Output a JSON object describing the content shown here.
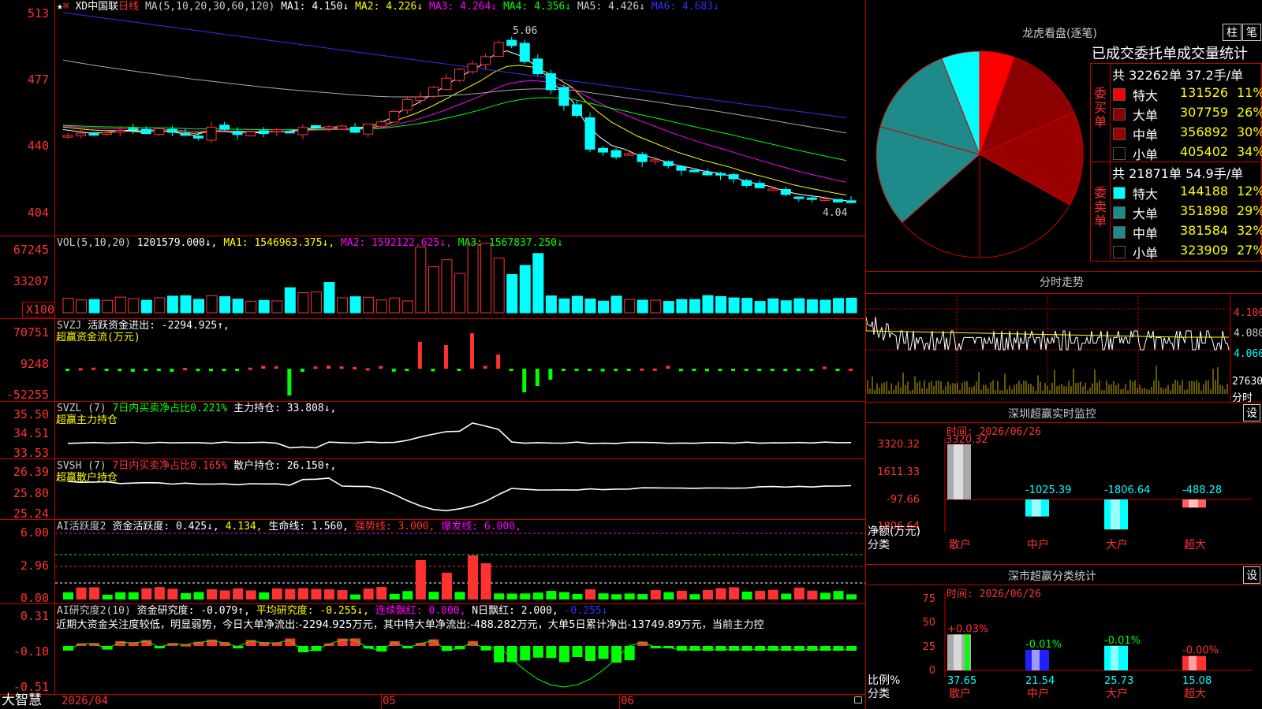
{
  "kline": {
    "title": "XD中国联",
    "period": "日线",
    "ma_label": "MA(5,10,20,30,60,120)",
    "ma1": "MA1: 4.150↓",
    "ma2": "MA2: 4.226↓",
    "ma3": "MA3: 4.264↓",
    "ma4": "MA4: 4.356↓",
    "ma5": "MA5: 4.426↓",
    "ma6": "MA6: 4.683↓",
    "y_ticks": [
      "513",
      "477",
      "440",
      "404"
    ],
    "high_note": "5.06",
    "low_note": "4.04"
  },
  "vol": {
    "label": "VOL(5,10,20)",
    "value": "1201579.000↓",
    "ma1": "MA1: 1546963.375↓",
    "ma2": "MA2: 1592122.625↓",
    "ma3": "MA3: 1567837.250↓",
    "y_ticks": [
      "67245",
      "33207",
      "X100"
    ]
  },
  "svzj": {
    "label": "SVZJ",
    "text": "活跃资金进出: -2294.925↑,",
    "sub": "超赢资金流(万元)",
    "y_ticks": [
      "70751",
      "9248",
      "-52255"
    ]
  },
  "svzl": {
    "label": "SVZL (7)",
    "text1": "7日内买卖净占比0.221%",
    "text2": "主力持仓: 33.808↓,",
    "sub": "超赢主力持仓",
    "y_ticks": [
      "35.50",
      "34.51",
      "33.53"
    ]
  },
  "svsh": {
    "label": "SVSH (7)",
    "text1": "7日内买卖净占比0.165%",
    "text2": "散户持仓: 26.150↑,",
    "sub": "超赢散户持仓",
    "y_ticks": [
      "26.39",
      "25.80",
      "25.24"
    ]
  },
  "ai1": {
    "label": "AI活跃度2",
    "t1": "资金活跃度: 0.425↓,",
    "t2": "4.134,",
    "t3": "生命线: 1.560,",
    "t4": "强势线: 3.000,",
    "t5": "爆发线: 6.000,",
    "y_ticks": [
      "6.00",
      "2.96",
      "0.00"
    ]
  },
  "ai2": {
    "label": "AI研究度2(10)",
    "t1": "资金研究度: -0.079↑,",
    "t2": "平均研究度: -0.255↓,",
    "t3": "连续飘红: 0.000,",
    "t4": "N日飘红: 2.000,",
    "t5": "-0.255↓",
    "comment": "近期大资金关注度较低，明显弱势，今日大单净流出:-2294.925万元，其中特大单净流出:-488.282万元，大单5日累计净出-13749.89万元，当前主力控",
    "y_ticks": [
      "0.31",
      "-0.10",
      "-0.51"
    ]
  },
  "xaxis": {
    "brand": "大智慧",
    "d1": "2026/04",
    "d2": "05",
    "d3": "06"
  },
  "lhb": {
    "title": "龙虎看盘(逐笔)",
    "tab1": "柱",
    "tab2": "笔",
    "stat_title": "已成交委托单成交量统计",
    "buy_side": "委买单",
    "sell_side": "委卖单",
    "buy_total": "共 32262单 37.2手/单",
    "sell_total": "共 21871单 54.9手/单",
    "buy_rows": [
      {
        "name": "特大",
        "vol": "131526",
        "pct": "11%",
        "color": "#ff0000"
      },
      {
        "name": "大单",
        "vol": "307759",
        "pct": "26%",
        "color": "#8b0000"
      },
      {
        "name": "中单",
        "vol": "356892",
        "pct": "30%",
        "color": "#9a0000"
      },
      {
        "name": "小单",
        "vol": "405402",
        "pct": "34%",
        "color": "#000000"
      }
    ],
    "sell_rows": [
      {
        "name": "特大",
        "vol": "144188",
        "pct": "12%",
        "color": "#00ffff"
      },
      {
        "name": "大单",
        "vol": "351898",
        "pct": "29%",
        "color": "#1f8a8a"
      },
      {
        "name": "中单",
        "vol": "381584",
        "pct": "32%",
        "color": "#1f8a8a"
      },
      {
        "name": "小单",
        "vol": "323909",
        "pct": "27%",
        "color": "#000000"
      }
    ]
  },
  "fenshi": {
    "title": "分时走势",
    "y_ticks": [
      "4.100",
      "4.080",
      "4.060"
    ],
    "vol_tick": "27630",
    "vol_label": "分时"
  },
  "monitor": {
    "title": "深圳超赢实时监控",
    "set": "设",
    "time": "时间: 2026/06/26",
    "y_ticks": [
      "3320.32",
      "1611.33",
      "-97.66",
      "-1806.64"
    ],
    "ylabel1": "净额(万元)",
    "ylabel2": "分类",
    "bar_labels": [
      "3320.32",
      "-1025.39",
      "-1806.64",
      "-488.28"
    ],
    "cats": [
      "散户",
      "中户",
      "大户",
      "超大"
    ]
  },
  "classify": {
    "title": "深市超赢分类统计",
    "set": "设",
    "time": "时间: 2026/06/26",
    "y_ticks": [
      "75",
      "50",
      "25",
      "0"
    ],
    "ylabel1": "比例%",
    "ylabel2": "分类",
    "top_labels": [
      "+0.03%",
      "-0.01%",
      "-0.01%",
      "-0.00%"
    ],
    "values": [
      "37.65",
      "21.54",
      "25.73",
      "15.08"
    ],
    "cats": [
      "散户",
      "中户",
      "大户",
      "超大"
    ]
  }
}
